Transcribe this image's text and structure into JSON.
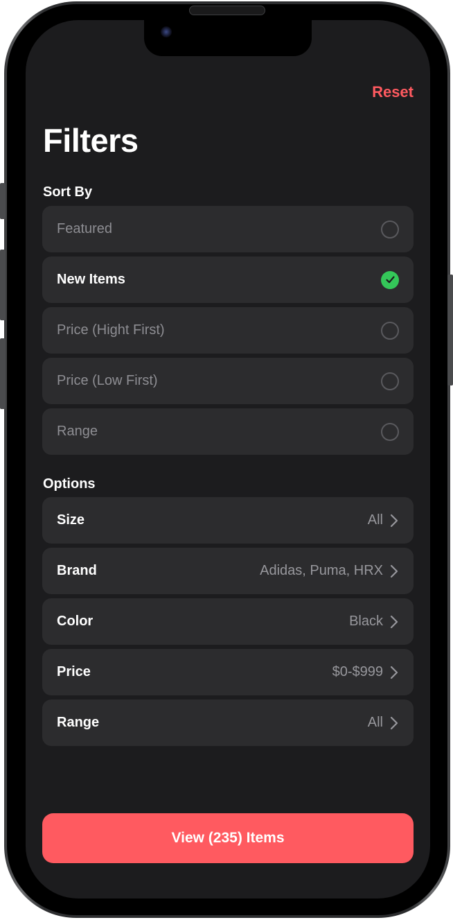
{
  "header": {
    "reset_label": "Reset",
    "title": "Filters"
  },
  "sort": {
    "section_label": "Sort By",
    "items": [
      {
        "label": "Featured",
        "selected": false
      },
      {
        "label": "New Items",
        "selected": true
      },
      {
        "label": "Price (Hight First)",
        "selected": false
      },
      {
        "label": "Price (Low First)",
        "selected": false
      },
      {
        "label": "Range",
        "selected": false
      }
    ]
  },
  "options": {
    "section_label": "Options",
    "items": [
      {
        "label": "Size",
        "value": "All"
      },
      {
        "label": "Brand",
        "value": "Adidas, Puma, HRX"
      },
      {
        "label": "Color",
        "value": "Black"
      },
      {
        "label": "Price",
        "value": "$0-$999"
      },
      {
        "label": "Range",
        "value": "All"
      }
    ]
  },
  "footer": {
    "cta_label": "View (235) Items"
  },
  "colors": {
    "accent": "#ff5a60",
    "check": "#34c759",
    "background": "#1c1c1e",
    "row": "#2c2c2e"
  },
  "icons": {
    "selected": "checkmark-circle-icon",
    "unselected": "empty-circle-icon",
    "disclosure": "chevron-right-icon"
  }
}
